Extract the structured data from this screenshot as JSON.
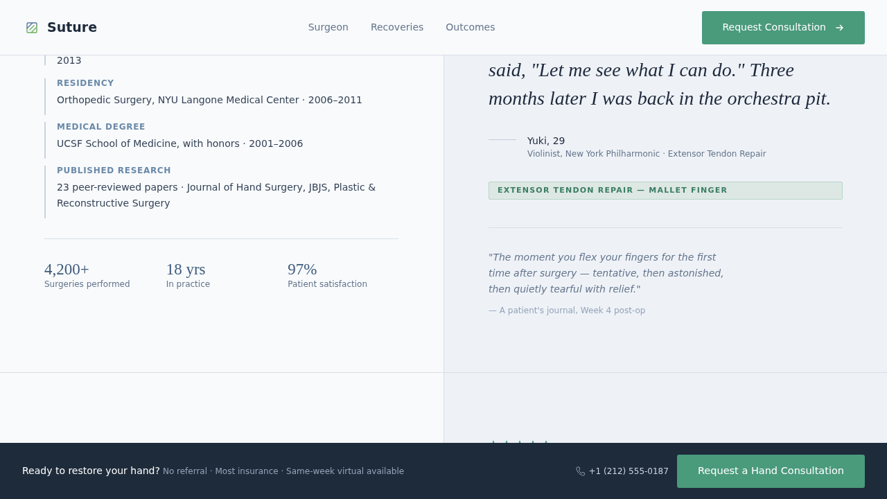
{
  "header": {
    "brand": "Suture",
    "nav": [
      {
        "label": "Surgeon"
      },
      {
        "label": "Recoveries"
      },
      {
        "label": "Outcomes"
      }
    ],
    "cta": "Request Consultation"
  },
  "credentials": [
    {
      "detail": "2013"
    },
    {
      "label": "RESIDENCY",
      "detail": "Orthopedic Surgery, NYU Langone Medical Center · 2006–2011"
    },
    {
      "label": "MEDICAL DEGREE",
      "detail": "UCSF School of Medicine, with honors · 2001–2006"
    },
    {
      "label": "PUBLISHED RESEARCH",
      "detail": "23 peer-reviewed papers · Journal of Hand Surgery, JBJS, Plastic & Reconstructive Surgery"
    }
  ],
  "stats": [
    {
      "value": "4,200+",
      "label": "Surgeries performed"
    },
    {
      "value": "18 yrs",
      "label": "In practice"
    },
    {
      "value": "97%",
      "label": "Patient satisfaction"
    }
  ],
  "testimonial": {
    "quote": "said, \"Let me see what I can do.\" Three months later I was back in the orchestra pit.",
    "name": "Yuki, 29",
    "role": "Violinist, New York Philharmonic · Extensor Tendon Repair",
    "tag": "EXTENSOR TENDON REPAIR — MALLET FINGER"
  },
  "journal": {
    "quote": "\"The moment you flex your fingers for the first time after surgery — tentative, then astonished, then quietly tearful with relief.\"",
    "source": "— A patient's journal, Week 4 post-op"
  },
  "footer": {
    "headline": "Ready to restore your hand?",
    "note": "No referral · Most insurance · Same-week virtual available",
    "phone": "+1 (212) 555-0187",
    "cta": "Request a Hand Consultation"
  }
}
